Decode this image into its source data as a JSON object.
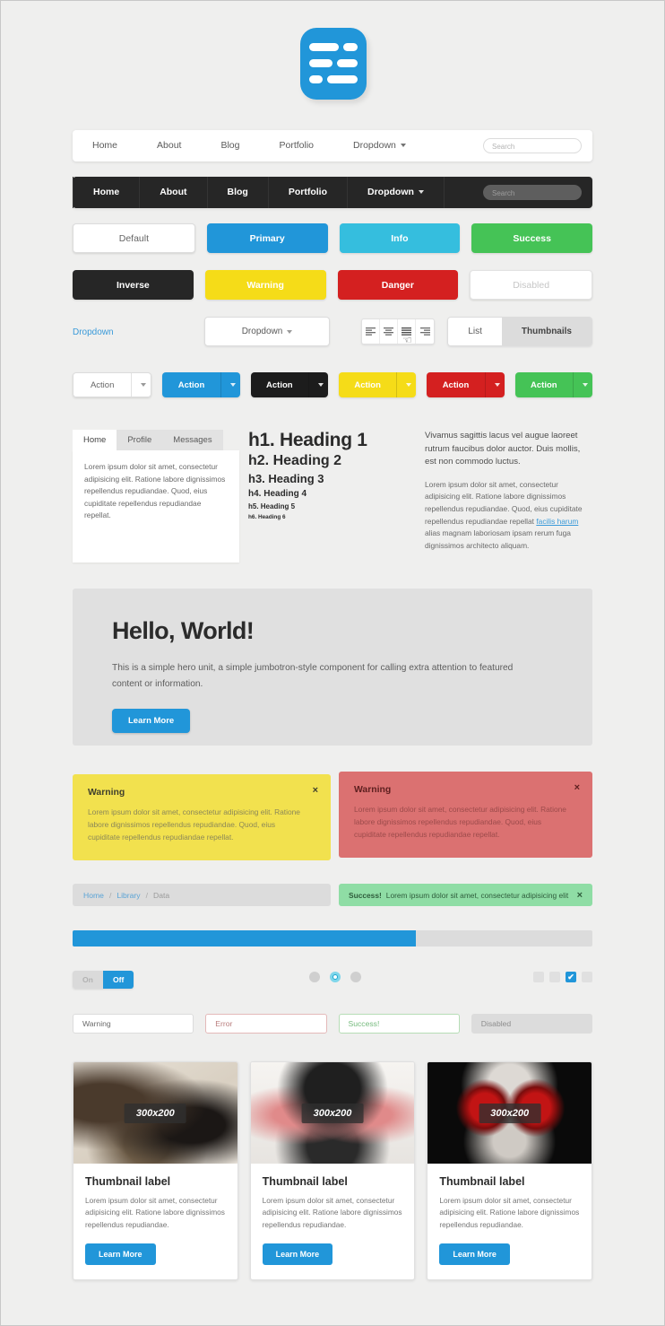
{
  "logo": {
    "name": "app-logo-icon",
    "color": "#2196d9"
  },
  "navbars": [
    {
      "variant": "light",
      "items": [
        "Home",
        "About",
        "Blog",
        "Portfolio",
        "Dropdown"
      ],
      "dropdown_index": 4,
      "search_placeholder": "Search"
    },
    {
      "variant": "dark",
      "items": [
        "Home",
        "About",
        "Blog",
        "Portfolio",
        "Dropdown"
      ],
      "dropdown_index": 4,
      "search_placeholder": "Search"
    }
  ],
  "buttons_row1": [
    {
      "label": "Default",
      "style": "default",
      "color": "#ffffff"
    },
    {
      "label": "Primary",
      "style": "solid",
      "color": "#2196d9"
    },
    {
      "label": "Info",
      "style": "solid",
      "color": "#35bede"
    },
    {
      "label": "Success",
      "style": "solid",
      "color": "#45c356"
    }
  ],
  "buttons_row2": [
    {
      "label": "Inverse",
      "style": "solid",
      "color": "#262626"
    },
    {
      "label": "Warning",
      "style": "solid",
      "color": "#f5dc18"
    },
    {
      "label": "Danger",
      "style": "solid",
      "color": "#d42020"
    },
    {
      "label": "Disabled",
      "style": "disabled",
      "color": "#ffffff"
    }
  ],
  "dropdown_row": {
    "link_label": "Dropdown",
    "button_label": "Dropdown",
    "align_icons": [
      "align-left-icon",
      "align-center-icon",
      "align-justify-icon",
      "align-right-icon"
    ],
    "align_hover_index": 2,
    "segmented": {
      "options": [
        "List",
        "Thumbnails"
      ],
      "active": "Thumbnails"
    }
  },
  "split_buttons": [
    {
      "label": "Action",
      "color": "#ffffff",
      "style": "white"
    },
    {
      "label": "Action",
      "color": "#2196d9",
      "style": "solid"
    },
    {
      "label": "Action",
      "color": "#1c1c1c",
      "style": "solid"
    },
    {
      "label": "Action",
      "color": "#f5dc18",
      "style": "solid"
    },
    {
      "label": "Action",
      "color": "#d42020",
      "style": "solid"
    },
    {
      "label": "Action",
      "color": "#45c356",
      "style": "solid"
    }
  ],
  "tabs_card": {
    "tabs": [
      "Home",
      "Profile",
      "Messages"
    ],
    "active": "Home",
    "body": "Lorem ipsum dolor sit amet, consectetur adipisicing elit. Ratione labore dignissimos repellendus repudiandae. Quod, eius cupiditate repellendus repudiandae repellat."
  },
  "headings": [
    "h1. Heading 1",
    "h2. Heading 2",
    "h3. Heading 3",
    "h4. Heading 4",
    "h5. Heading 5",
    "h6. Heading 6"
  ],
  "text_column": {
    "lead": "Vivamus sagittis lacus vel augue laoreet rutrum faucibus dolor auctor. Duis mollis, est non commodo luctus.",
    "para_before": "Lorem ipsum dolor sit amet, consectetur adipisicing elit. Ratione labore dignissimos repellendus repudiandae. Quod, eius cupiditate repellendus repudiandae repellat ",
    "link": "facilis harum",
    "para_after": " alias magnam laboriosam ipsam rerum fuga dignissimos architecto aliquam."
  },
  "jumbotron": {
    "title": "Hello, World!",
    "body": "This is a simple hero unit, a simple jumbotron-style component for calling extra attention to featured content or information.",
    "button": "Learn More"
  },
  "alerts": [
    {
      "title": "Warning",
      "body": "Lorem ipsum dolor sit amet, consectetur adipisicing elit. Ratione labore dignissimos repellendus repudiandae. Quod, eius cupiditate repellendus repudiandae repellat.",
      "close": "×",
      "color": "#f2e14e"
    },
    {
      "title": "Warning",
      "body": "Lorem ipsum dolor sit amet, consectetur adipisicing elit. Ratione labore dignissimos repellendus repudiandae. Quod, eius cupiditate repellendus repudiandae repellat.",
      "close": "×",
      "color": "#db7171"
    }
  ],
  "breadcrumb": {
    "items": [
      "Home",
      "Library",
      "Data"
    ],
    "separator": "/"
  },
  "success_alert": {
    "strong": "Success!",
    "text": "Lorem ipsum dolor sit amet, consectetur adipisicing elit",
    "close": "×",
    "color": "#8fdda5"
  },
  "progress": {
    "percent": 66,
    "color": "#2196d9"
  },
  "toggle": {
    "off_label": "On",
    "on_label": "Off",
    "active": "Off"
  },
  "radios": {
    "count": 3,
    "selected_index": 1
  },
  "checkboxes": {
    "count": 4,
    "checked_index": 2,
    "check_glyph": "✔"
  },
  "inputs": [
    {
      "value": "Warning",
      "state": "normal"
    },
    {
      "value": "Error",
      "state": "error"
    },
    {
      "value": "Success!",
      "state": "success"
    },
    {
      "value": "Disabled",
      "state": "disabled"
    }
  ],
  "thumbnails": [
    {
      "placeholder": "300x200",
      "title": "Thumbnail label",
      "body": "Lorem ipsum dolor sit amet, consectetur adipisicing elit. Ratione labore dignissimos repellendus repudiandae.",
      "button": "Learn More"
    },
    {
      "placeholder": "300x200",
      "title": "Thumbnail label",
      "body": "Lorem ipsum dolor sit amet, consectetur adipisicing elit. Ratione labore dignissimos repellendus repudiandae.",
      "button": "Learn More"
    },
    {
      "placeholder": "300x200",
      "title": "Thumbnail label",
      "body": "Lorem ipsum dolor sit amet, consectetur adipisicing elit. Ratione labore dignissimos repellendus repudiandae.",
      "button": "Learn More"
    }
  ]
}
